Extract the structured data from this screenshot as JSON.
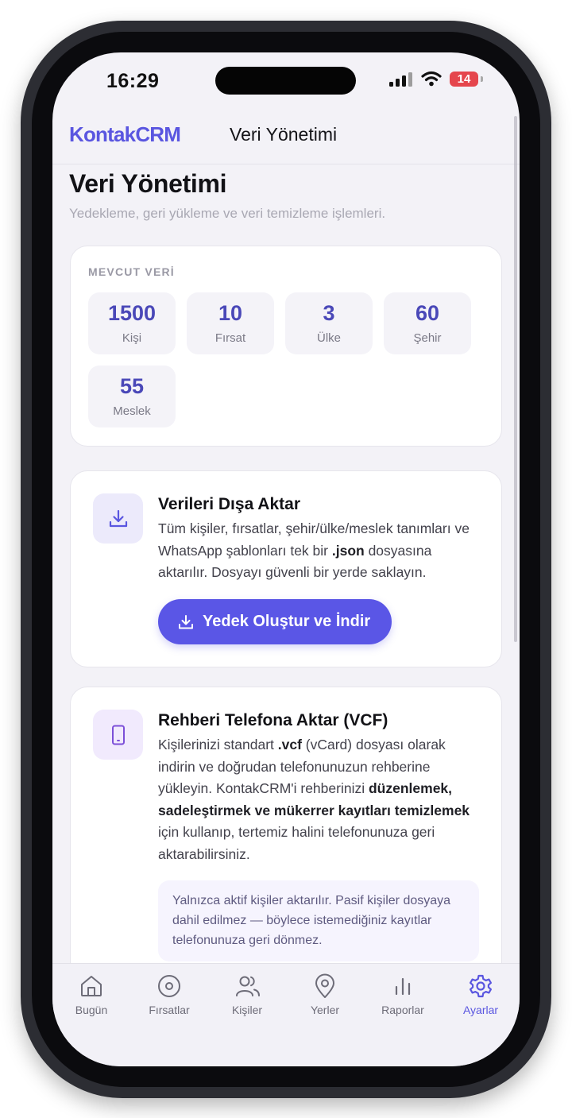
{
  "status_bar": {
    "time": "16:29",
    "battery": "14"
  },
  "header": {
    "brand": "KontakCRM",
    "title": "Veri Yönetimi"
  },
  "page": {
    "title": "Veri Yönetimi",
    "subtitle": "Yedekleme, geri yükleme ve veri temizleme işlemleri."
  },
  "stats": {
    "heading": "MEVCUT VERİ",
    "items": [
      {
        "value": "1500",
        "label": "Kişi"
      },
      {
        "value": "10",
        "label": "Fırsat"
      },
      {
        "value": "3",
        "label": "Ülke"
      },
      {
        "value": "60",
        "label": "Şehir"
      },
      {
        "value": "55",
        "label": "Meslek"
      }
    ]
  },
  "export": {
    "icon": "download-icon",
    "title": "Verileri Dışa Aktar",
    "text_1": "Tüm kişiler, fırsatlar, şehir/ülke/meslek tanımları ve WhatsApp şablonları tek bir ",
    "text_bold": ".json",
    "text_2": " dosyasına aktarılır. Dosyayı güvenli bir yerde saklayın.",
    "button_label": "Yedek Oluştur ve İndir"
  },
  "vcf": {
    "icon": "phone-icon",
    "title": "Rehberi Telefona Aktar (VCF)",
    "text_1": "Kişilerinizi standart ",
    "text_bold_1": ".vcf",
    "text_2": " (vCard) dosyası olarak indirin ve doğrudan telefonunuzun rehberine yükleyin. KontakCRM'i rehberinizi ",
    "text_bold_2": "düzenlemek, sadeleştirmek ve mükerrer kayıtları temizlemek",
    "text_3": " için kullanıp, tertemiz halini telefonunuza geri aktarabilirsiniz.",
    "note": "Yalnızca aktif kişiler aktarılır. Pasif kişiler dosyaya dahil edilmez — böylece istemediğiniz kayıtlar telefonunuza geri dönmez."
  },
  "nav": [
    {
      "label": "Bugün",
      "icon": "home-icon"
    },
    {
      "label": "Fırsatlar",
      "icon": "target-icon"
    },
    {
      "label": "Kişiler",
      "icon": "users-icon"
    },
    {
      "label": "Yerler",
      "icon": "map-pin-icon"
    },
    {
      "label": "Raporlar",
      "icon": "bar-chart-icon"
    },
    {
      "label": "Ayarlar",
      "icon": "gear-icon",
      "active": true
    }
  ],
  "colors": {
    "accent": "#5a56e6",
    "brand": "#5a56e0",
    "background": "#f3f2f7",
    "battery_low": "#e5464d"
  }
}
